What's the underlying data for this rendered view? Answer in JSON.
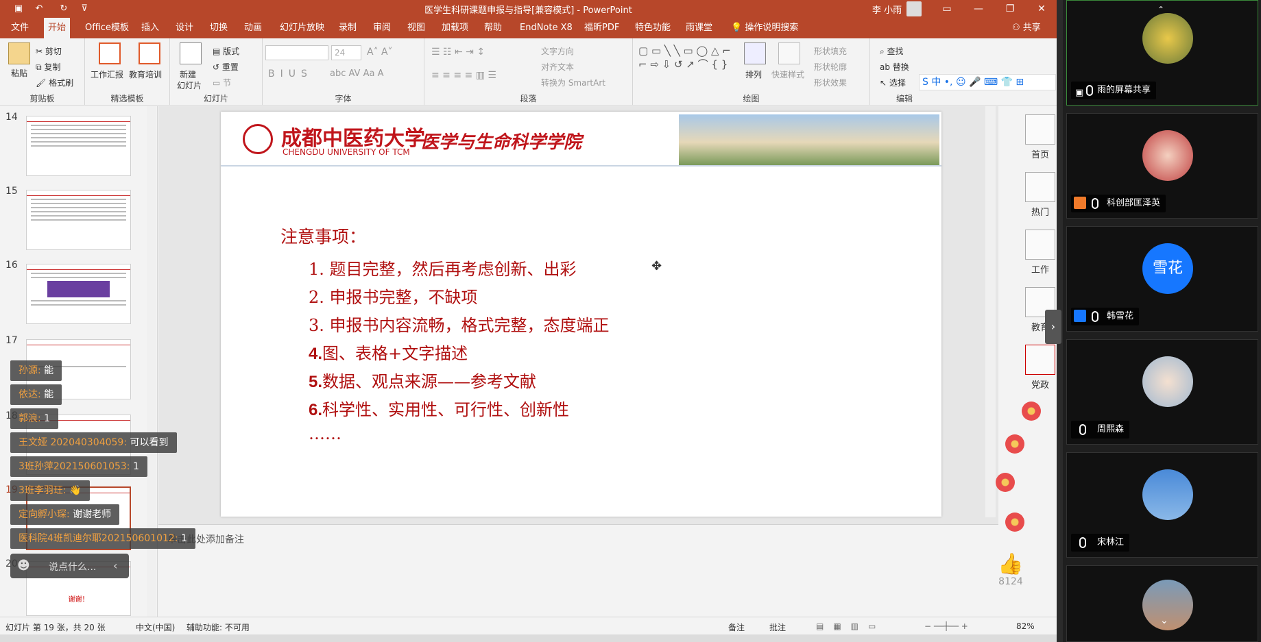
{
  "window": {
    "title": "医学生科研课题申报与指导[兼容模式]  -  PowerPoint",
    "user": "李 小雨"
  },
  "tabs": [
    "文件",
    "开始",
    "Office模板",
    "插入",
    "设计",
    "切换",
    "动画",
    "幻灯片放映",
    "录制",
    "审阅",
    "视图",
    "加载项",
    "帮助",
    "EndNote X8",
    "福昕PDF",
    "特色功能",
    "雨课堂"
  ],
  "tell_me": "操作说明搜索",
  "share": "共享",
  "ribbon": {
    "clipboard": {
      "paste": "粘贴",
      "cut": "剪切",
      "copy": "复制",
      "painter": "格式刷",
      "label": "剪贴板"
    },
    "templates": {
      "work": "工作汇报",
      "edu": "教育培训",
      "label": "精选模板"
    },
    "slides": {
      "new": "新建",
      "new2": "幻灯片",
      "layout": "版式",
      "reset": "重置",
      "section": "节",
      "label": "幻灯片"
    },
    "font": {
      "size": "24",
      "label": "字体"
    },
    "paragraph": {
      "textdir": "文字方向",
      "align": "对齐文本",
      "smartart": "转换为 SmartArt",
      "label": "段落"
    },
    "drawing": {
      "arrange": "排列",
      "quick": "快速样式",
      "fill": "形状填充",
      "outline": "形状轮廓",
      "effect": "形状效果",
      "label": "绘图"
    },
    "editing": {
      "find": "查找",
      "replace": "替换",
      "select": "选择",
      "label": "编辑"
    }
  },
  "thumbnails": [
    {
      "n": "14"
    },
    {
      "n": "15"
    },
    {
      "n": "16"
    },
    {
      "n": "17"
    },
    {
      "n": "18"
    },
    {
      "n": "19"
    },
    {
      "n": "20"
    }
  ],
  "slide": {
    "school_cn": "成都中医药大学",
    "school_en": "CHENGDU UNIVERSITY OF TCM",
    "college": "医学与生命科学学院",
    "heading": "注意事项：",
    "items": [
      {
        "num": "1.",
        "text": "题目完整，然后再考虑创新、出彩"
      },
      {
        "num": "2.",
        "text": "申报书完整，不缺项"
      },
      {
        "num": "3.",
        "text": "申报书内容流畅，格式完整，态度端正"
      },
      {
        "num": "4.",
        "text": "图、表格+文字描述"
      },
      {
        "num": "5.",
        "text": "数据、观点来源——参考文献"
      },
      {
        "num": "6.",
        "text": "科学性、实用性、可行性、创新性"
      },
      {
        "num": "",
        "text": "……"
      }
    ]
  },
  "notes_placeholder": "单击此处添加备注",
  "status": {
    "slide": "幻灯片 第 19 张，共 20 张",
    "lang": "中文(中国)",
    "access": "辅助功能: 不可用",
    "notes": "备注",
    "comments": "批注",
    "zoom": "82%"
  },
  "side_panel": [
    {
      "label": "首页"
    },
    {
      "label": "热门"
    },
    {
      "label": "工作"
    },
    {
      "label": "教育"
    },
    {
      "label": "党政"
    }
  ],
  "likes": "8124",
  "chat": [
    {
      "name": "孙源:",
      "text": "能"
    },
    {
      "name": "依达:",
      "text": "能"
    },
    {
      "name": "郭浪:",
      "text": "1"
    },
    {
      "name": "王文娅 202040304059:",
      "text": "可以看到"
    },
    {
      "name": "3班孙萍202150601053:",
      "text": "1"
    },
    {
      "name": "3班李羽玨:",
      "text": "👋"
    },
    {
      "name": "定向孵小琛:",
      "text": "谢谢老师"
    },
    {
      "name": "医科院4班凯迪尔耶202150601012:",
      "text": "1"
    }
  ],
  "chat_placeholder": "说点什么...",
  "participants": [
    {
      "name": "雨的屏幕共享"
    },
    {
      "name": "科创部匡泽英"
    },
    {
      "name": "韩雪花",
      "avatar_text": "雪花"
    },
    {
      "name": "周熙森"
    },
    {
      "name": "宋林江"
    },
    {
      "name": ""
    }
  ],
  "colors": {
    "accent": "#b7472a",
    "slide_text": "#b01010"
  }
}
